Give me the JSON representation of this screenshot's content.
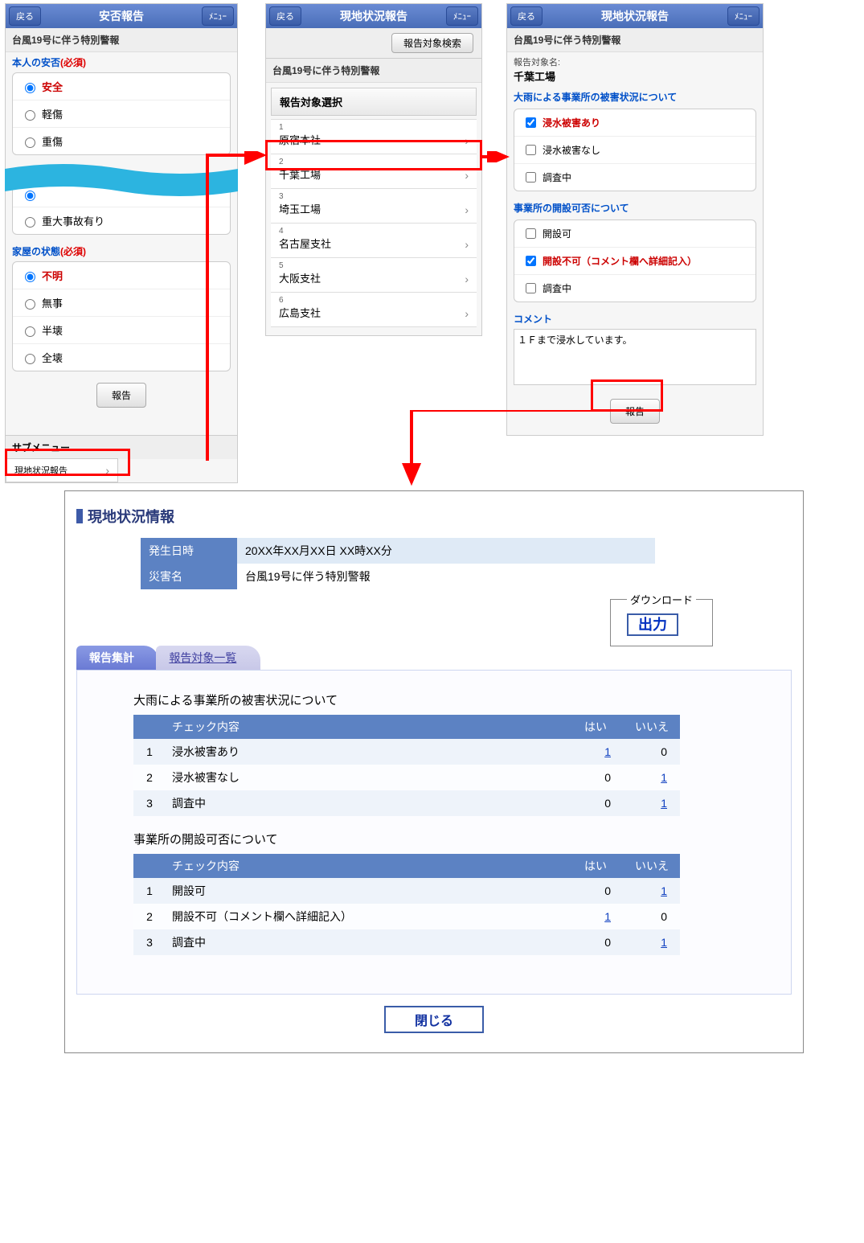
{
  "common": {
    "back": "戻る",
    "menu": "ﾒﾆｭｰ",
    "event": "台風19号に伴う特別警報",
    "report_btn": "報告",
    "required": "(必須)"
  },
  "panel1": {
    "title": "安否報告",
    "g1": {
      "label": "本人の安否",
      "opts": [
        "安全",
        "軽傷",
        "重傷"
      ],
      "sel": 0
    },
    "g2": {
      "label": "(必須)",
      "opts": [
        "",
        "重大事故有り"
      ],
      "sel": 0
    },
    "g3": {
      "label": "家屋の状態",
      "opts": [
        "不明",
        "無事",
        "半壊",
        "全壊"
      ],
      "sel": 0
    },
    "submenu_label": "サブメニュー",
    "submenu_item": "現地状況報告"
  },
  "panel2": {
    "title": "現地状況報告",
    "search_btn": "報告対象検索",
    "list_header": "報告対象選択",
    "items": [
      {
        "n": "1",
        "label": "原宿本社"
      },
      {
        "n": "2",
        "label": "千葉工場"
      },
      {
        "n": "3",
        "label": "埼玉工場"
      },
      {
        "n": "4",
        "label": "名古屋支社"
      },
      {
        "n": "5",
        "label": "大阪支社"
      },
      {
        "n": "6",
        "label": "広島支社"
      }
    ]
  },
  "panel3": {
    "title": "現地状況報告",
    "target_label": "報告対象名:",
    "target_value": "千葉工場",
    "g1": {
      "label": "大雨による事業所の被害状況について",
      "opts": [
        "浸水被害あり",
        "浸水被害なし",
        "調査中"
      ],
      "checked": [
        true,
        false,
        false
      ]
    },
    "g2": {
      "label": "事業所の開設可否について",
      "opts": [
        "開設可",
        "開設不可（コメント欄へ詳細記入）",
        "調査中"
      ],
      "checked": [
        false,
        true,
        false
      ]
    },
    "comment_label": "コメント",
    "comment_value": "１Ｆまで浸水しています。"
  },
  "summary": {
    "title": "現地状況情報",
    "rows": [
      {
        "th": "発生日時",
        "td": "20XX年XX月XX日 XX時XX分"
      },
      {
        "th": "災害名",
        "td": "台風19号に伴う特別警報"
      }
    ],
    "dl_legend": "ダウンロード",
    "dl_btn": "出力",
    "tab1": "報告集計",
    "tab2": "報告対象一覧",
    "sec1_title": "大雨による事業所の被害状況について",
    "sec2_title": "事業所の開設可否について",
    "cols": {
      "check": "チェック内容",
      "yes": "はい",
      "no": "いいえ"
    },
    "t1": [
      {
        "n": "1",
        "label": "浸水被害あり",
        "yes": "1",
        "no": "0",
        "yes_link": true
      },
      {
        "n": "2",
        "label": "浸水被害なし",
        "yes": "0",
        "no": "1",
        "no_link": true
      },
      {
        "n": "3",
        "label": "調査中",
        "yes": "0",
        "no": "1",
        "no_link": true
      }
    ],
    "t2": [
      {
        "n": "1",
        "label": "開設可",
        "yes": "0",
        "no": "1",
        "no_link": true
      },
      {
        "n": "2",
        "label": "開設不可（コメント欄へ詳細記入）",
        "yes": "1",
        "no": "0",
        "yes_link": true
      },
      {
        "n": "3",
        "label": "調査中",
        "yes": "0",
        "no": "1",
        "no_link": true
      }
    ],
    "close": "閉じる"
  }
}
